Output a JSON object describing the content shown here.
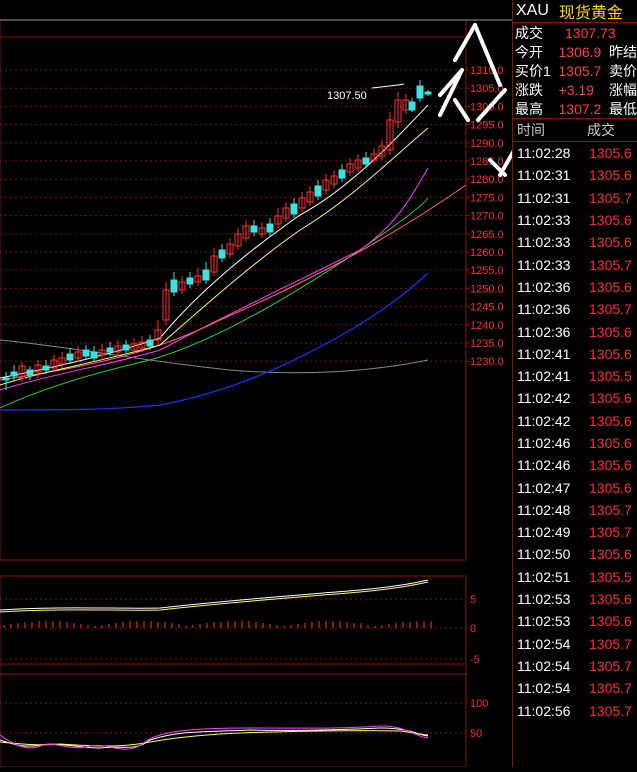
{
  "main_chart": {
    "price_label": "1307.50",
    "y_axis_labels": [
      "1310.0",
      "1305.0",
      "1300.0",
      "1295.0",
      "1290.0",
      "1285.0",
      "1280.0",
      "1275.0",
      "1270.0",
      "1265.0",
      "1260.0",
      "1255.0",
      "1250.0",
      "1245.0",
      "1240.0",
      "1235.0",
      "1230.0"
    ]
  },
  "macd_panel": {
    "y_axis_labels": [
      "5",
      "0",
      "-5"
    ]
  },
  "kdj_panel": {
    "y_axis_labels": [
      "100",
      "50"
    ]
  },
  "quote": {
    "symbol": "XAU",
    "name": "现货黄金",
    "rows": [
      {
        "label": "成交",
        "value": "1307.73",
        "label2": ""
      },
      {
        "label": "今开",
        "value": "1306.9",
        "label2": "昨结"
      },
      {
        "label": "买价1",
        "value": "1305.7",
        "label2": "卖价"
      },
      {
        "label": "涨跌",
        "value": "+3.19",
        "label2": "涨幅"
      },
      {
        "label": "最高",
        "value": "1307.2",
        "label2": "最低"
      }
    ]
  },
  "ticks": {
    "headers": [
      "时间",
      "成交"
    ],
    "rows": [
      {
        "time": "11:02:28",
        "price": "1305.6"
      },
      {
        "time": "11:02:31",
        "price": "1305.6"
      },
      {
        "time": "11:02:31",
        "price": "1305.7"
      },
      {
        "time": "11:02:33",
        "price": "1305.6"
      },
      {
        "time": "11:02:33",
        "price": "1305.6"
      },
      {
        "time": "11:02:33",
        "price": "1305.7"
      },
      {
        "time": "11:02:36",
        "price": "1305.6"
      },
      {
        "time": "11:02:36",
        "price": "1305.7"
      },
      {
        "time": "11:02:36",
        "price": "1305.6"
      },
      {
        "time": "11:02:41",
        "price": "1305.6"
      },
      {
        "time": "11:02:41",
        "price": "1305.5"
      },
      {
        "time": "11:02:42",
        "price": "1305.6"
      },
      {
        "time": "11:02:42",
        "price": "1305.6"
      },
      {
        "time": "11:02:46",
        "price": "1305.6"
      },
      {
        "time": "11:02:46",
        "price": "1305.6"
      },
      {
        "time": "11:02:47",
        "price": "1305.6"
      },
      {
        "time": "11:02:48",
        "price": "1305.7"
      },
      {
        "time": "11:02:49",
        "price": "1305.7"
      },
      {
        "time": "11:02:50",
        "price": "1305.6"
      },
      {
        "time": "11:02:51",
        "price": "1305.5"
      },
      {
        "time": "11:02:53",
        "price": "1305.6"
      },
      {
        "time": "11:02:53",
        "price": "1305.6"
      },
      {
        "time": "11:02:54",
        "price": "1305.7"
      },
      {
        "time": "11:02:54",
        "price": "1305.7"
      },
      {
        "time": "11:02:54",
        "price": "1305.7"
      },
      {
        "time": "11:02:56",
        "price": "1305.7"
      }
    ]
  },
  "colors": {
    "grid": "#8b1010",
    "up": "#ff3030",
    "down": "#40e0e0",
    "ma_white": "#ffffff",
    "ma_yellow": "#ffff60",
    "ma_magenta": "#ff40ff",
    "ma_green": "#30d030",
    "ma_blue": "#2030ff",
    "ma_gray": "#888888"
  }
}
